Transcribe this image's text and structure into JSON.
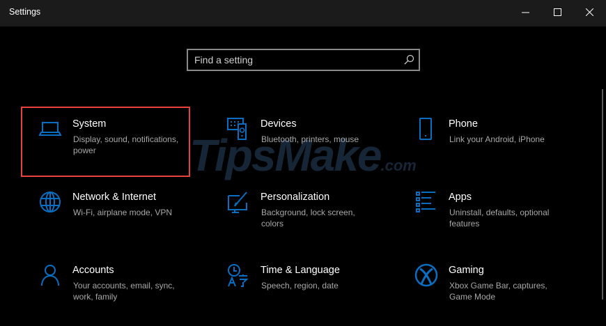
{
  "window": {
    "title": "Settings",
    "minimize": "—",
    "maximize": "☐",
    "close": "✕"
  },
  "search": {
    "placeholder": "Find a setting"
  },
  "watermark": {
    "text": "TipsMake",
    ".com": ".com"
  },
  "accent": "#0a6fc2",
  "selection_color": "#e8413e",
  "tiles": [
    {
      "title": "System",
      "desc": "Display, sound, notifications, power",
      "icon": "laptop-icon"
    },
    {
      "title": "Devices",
      "desc": "Bluetooth, printers, mouse",
      "icon": "devices-icon"
    },
    {
      "title": "Phone",
      "desc": "Link your Android, iPhone",
      "icon": "phone-icon"
    },
    {
      "title": "Network & Internet",
      "desc": "Wi-Fi, airplane mode, VPN",
      "icon": "globe-icon"
    },
    {
      "title": "Personalization",
      "desc": "Background, lock screen, colors",
      "icon": "paint-icon"
    },
    {
      "title": "Apps",
      "desc": "Uninstall, defaults, optional features",
      "icon": "apps-list-icon"
    },
    {
      "title": "Accounts",
      "desc": "Your accounts, email, sync, work, family",
      "icon": "person-icon"
    },
    {
      "title": "Time & Language",
      "desc": "Speech, region, date",
      "icon": "time-language-icon"
    },
    {
      "title": "Gaming",
      "desc": "Xbox Game Bar, captures, Game Mode",
      "icon": "xbox-icon"
    }
  ]
}
